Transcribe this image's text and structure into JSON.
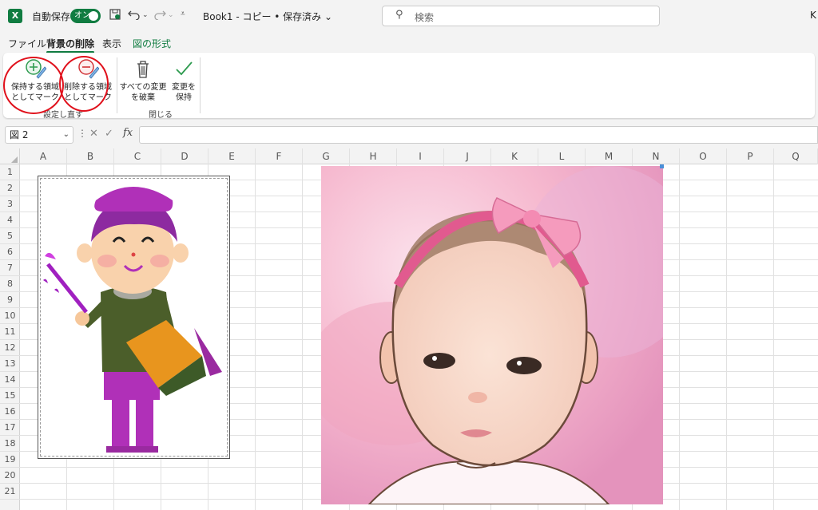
{
  "titlebar": {
    "app_icon": "X",
    "autosave_label": "自動保存",
    "autosave_toggle": "オン",
    "doc_title": "Book1 - コピー • 保存済み ⌄",
    "search_placeholder": "検索",
    "edge_text": "K"
  },
  "tabs": [
    "ファイル",
    "背景の削除",
    "表示",
    "図の形式"
  ],
  "ribbon": {
    "mark_keep": "保持する領域\nとしてマーク",
    "mark_remove": "削除する領域\nとしてマーク",
    "group_refine": "設定し直す",
    "discard": "すべての変更\nを破棄",
    "keep_changes": "変更を\n保持",
    "group_close": "閉じる"
  },
  "formula_bar": {
    "name_box": "図 2",
    "fx": "fx",
    "formula": ""
  },
  "columns": [
    "A",
    "B",
    "C",
    "D",
    "E",
    "F",
    "G",
    "H",
    "I",
    "J",
    "K",
    "L",
    "M",
    "N",
    "O",
    "P",
    "Q"
  ],
  "rows": [
    "1",
    "2",
    "3",
    "4",
    "5",
    "6",
    "7",
    "8",
    "9",
    "10",
    "11",
    "12",
    "13",
    "14",
    "15",
    "16",
    "17",
    "18",
    "19",
    "20",
    "21"
  ],
  "colors": {
    "excel_green": "#107c41",
    "annotation_red": "#e0101b",
    "ribbon_bg": "#f3f3f3"
  }
}
